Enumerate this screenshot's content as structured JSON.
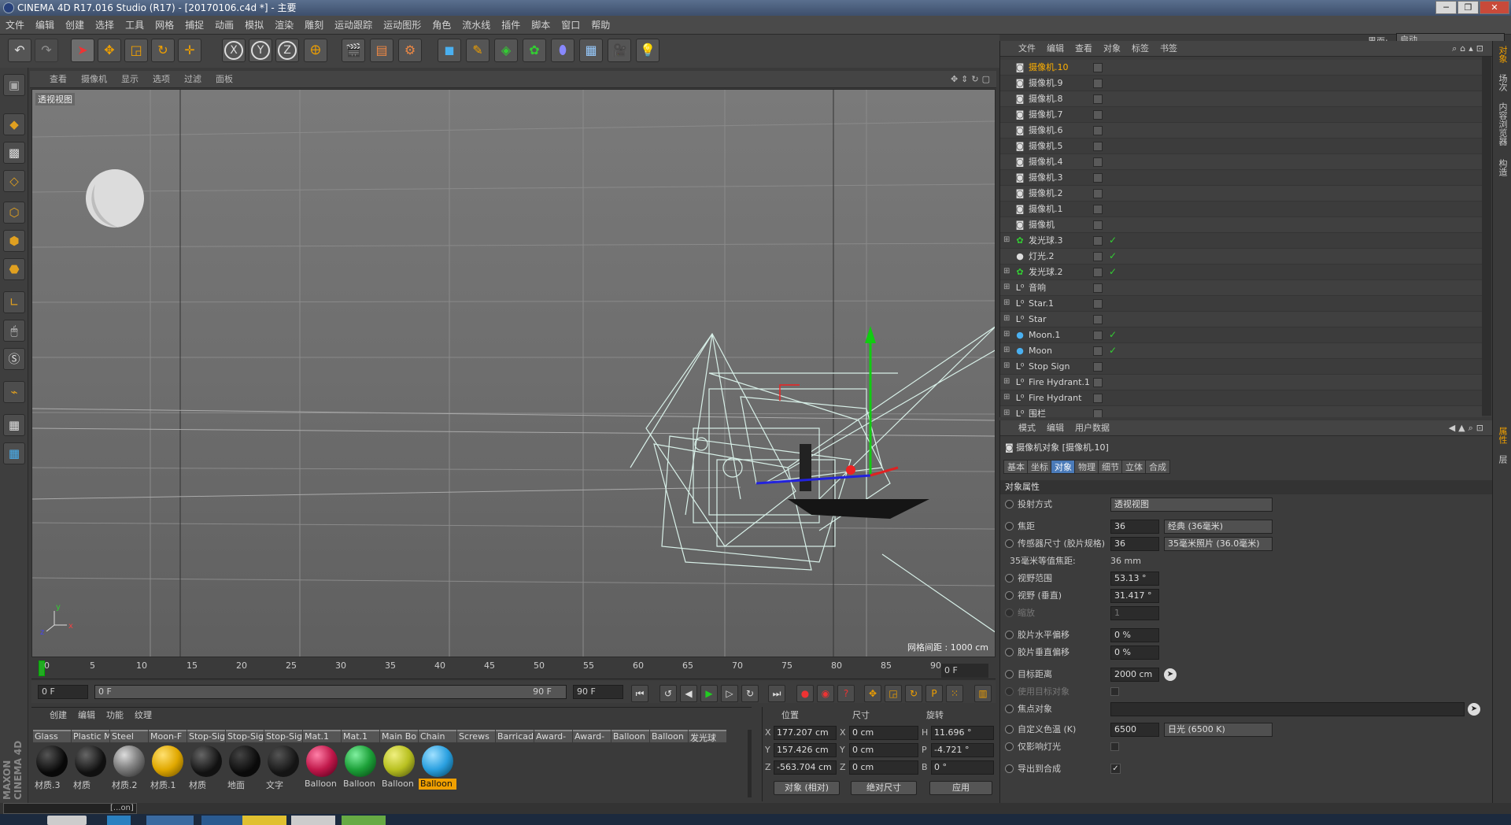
{
  "window": {
    "title": "CINEMA 4D R17.016 Studio (R17) - [20170106.c4d *] - 主要",
    "buttons": [
      "─",
      "❐",
      "✕"
    ]
  },
  "menu": [
    "文件",
    "编辑",
    "创建",
    "选择",
    "工具",
    "网格",
    "捕捉",
    "动画",
    "模拟",
    "渲染",
    "雕刻",
    "运动跟踪",
    "运动图形",
    "角色",
    "流水线",
    "插件",
    "脚本",
    "窗口",
    "帮助"
  ],
  "layout": {
    "label": "界面:",
    "value": "启动"
  },
  "toolbar": {
    "icons": [
      "undo-icon",
      "redo-icon",
      "select-arrow-icon",
      "move-icon",
      "scale-icon",
      "rotate-icon",
      "recent-tool-icon",
      "x-axis-icon",
      "y-axis-icon",
      "z-axis-icon",
      "world-coord-icon",
      "render-view-icon",
      "render-picture-viewer-icon",
      "render-settings-icon",
      "cube-icon",
      "pen-icon",
      "subdivision-icon",
      "cloner-icon",
      "deformer-icon",
      "floor-icon",
      "camera-icon",
      "light-icon"
    ],
    "axis_labels": [
      "X",
      "Y",
      "Z"
    ]
  },
  "viewport": {
    "menu": [
      "查看",
      "摄像机",
      "显示",
      "选项",
      "过滤",
      "面板"
    ],
    "label": "透视视图",
    "grid_info": "网格间距 : 1000 cm"
  },
  "timeline": {
    "ticks": [
      "0",
      "5",
      "10",
      "15",
      "20",
      "25",
      "30",
      "35",
      "40",
      "45",
      "50",
      "55",
      "60",
      "65",
      "70",
      "75",
      "80",
      "85",
      "90"
    ],
    "current": "0 F"
  },
  "playback": {
    "start": "0 F",
    "range_start": "0 F",
    "range_end": "90 F",
    "end": "90 F"
  },
  "materials": {
    "menu": [
      "创建",
      "编辑",
      "功能",
      "纹理"
    ],
    "items": [
      {
        "tab": "Glass",
        "label": "材质.3",
        "color": "#080808"
      },
      {
        "tab": "Plastic M",
        "label": "材质",
        "color": "#101010"
      },
      {
        "tab": "Steel",
        "label": "材质.2",
        "color": "#8a8a8a"
      },
      {
        "tab": "Moon-F",
        "label": "材质.1",
        "color": "#e0a800"
      },
      {
        "tab": "Stop-Sig",
        "label": "材质",
        "color": "#111111"
      },
      {
        "tab": "Stop-Sig",
        "label": "地面",
        "color": "#0a0a0a"
      },
      {
        "tab": "Stop-Sig",
        "label": "文字",
        "color": "#141414"
      },
      {
        "tab": "Mat.1",
        "label": "Balloon",
        "color": "#c0184a"
      },
      {
        "tab": "Mat.1",
        "label": "Balloon",
        "color": "#1ca038"
      },
      {
        "tab": "Main Bo",
        "label": "Balloon",
        "color": "#b8c020"
      },
      {
        "tab": "Chain",
        "label": "Balloon",
        "color": "#2aa0e0"
      }
    ],
    "extra_tabs": [
      "Screws",
      "Barricad",
      "Award-",
      "Award-",
      "Balloon",
      "Balloon",
      "发光球"
    ]
  },
  "coords": {
    "headers": [
      "位置",
      "尺寸",
      "旋转"
    ],
    "rows": [
      {
        "a": "X",
        "pos": "177.207 cm",
        "b": "X",
        "size": "0 cm",
        "c": "H",
        "rot": "11.696 °"
      },
      {
        "a": "Y",
        "pos": "157.426 cm",
        "b": "Y",
        "size": "0 cm",
        "c": "P",
        "rot": "-4.721 °"
      },
      {
        "a": "Z",
        "pos": "-563.704 cm",
        "b": "Z",
        "size": "0 cm",
        "c": "B",
        "rot": "0 °"
      }
    ],
    "mode1": "对象 (相对)",
    "mode2": "绝对尺寸",
    "apply": "应用"
  },
  "objects": {
    "menu": [
      "文件",
      "编辑",
      "查看",
      "对象",
      "标签",
      "书签"
    ],
    "items": [
      {
        "name": "摄像机.10",
        "icon": "camera-icon",
        "selected": true
      },
      {
        "name": "摄像机.9",
        "icon": "camera-icon"
      },
      {
        "name": "摄像机.8",
        "icon": "camera-icon"
      },
      {
        "name": "摄像机.7",
        "icon": "camera-icon"
      },
      {
        "name": "摄像机.6",
        "icon": "camera-icon"
      },
      {
        "name": "摄像机.5",
        "icon": "camera-icon"
      },
      {
        "name": "摄像机.4",
        "icon": "camera-icon"
      },
      {
        "name": "摄像机.3",
        "icon": "camera-icon"
      },
      {
        "name": "摄像机.2",
        "icon": "camera-icon"
      },
      {
        "name": "摄像机.1",
        "icon": "camera-icon"
      },
      {
        "name": "摄像机",
        "icon": "camera-icon"
      },
      {
        "name": "发光球.3",
        "icon": "cloner-icon"
      },
      {
        "name": "灯光.2",
        "icon": "light-icon"
      },
      {
        "name": "发光球.2",
        "icon": "cloner-icon"
      },
      {
        "name": "音响",
        "icon": "null-icon"
      },
      {
        "name": "Star.1",
        "icon": "null-icon"
      },
      {
        "name": "Star",
        "icon": "null-icon"
      },
      {
        "name": "Moon.1",
        "icon": "sphere-icon"
      },
      {
        "name": "Moon",
        "icon": "sphere-icon"
      },
      {
        "name": "Stop Sign",
        "icon": "null-icon"
      },
      {
        "name": "Fire Hydrant.1",
        "icon": "null-icon"
      },
      {
        "name": "Fire Hydrant",
        "icon": "null-icon"
      },
      {
        "name": "围栏",
        "icon": "null-icon"
      }
    ]
  },
  "attributes": {
    "menu": [
      "模式",
      "编辑",
      "用户数据"
    ],
    "title": "摄像机对象 [摄像机.10]",
    "tabs": [
      "基本",
      "坐标",
      "对象",
      "物理",
      "细节",
      "立体",
      "合成"
    ],
    "section": "对象属性",
    "rows": [
      {
        "label": "投射方式",
        "value": "",
        "dropdown": "透视视图"
      },
      {
        "label": "焦距",
        "value": "36",
        "dropdown": "经典 (36毫米)"
      },
      {
        "label": "传感器尺寸 (胶片规格)",
        "value": "36",
        "dropdown": "35毫米照片 (36.0毫米)"
      },
      {
        "label": "35毫米等值焦距:",
        "value": "36 mm",
        "dropdown": ""
      },
      {
        "label": "视野范围",
        "value": "53.13 °",
        "dropdown": ""
      },
      {
        "label": "视野 (垂直)",
        "value": "31.417 °",
        "dropdown": ""
      },
      {
        "label": "缩放",
        "value": "1",
        "dropdown": ""
      },
      {
        "label": "胶片水平偏移",
        "value": "0 %",
        "dropdown": ""
      },
      {
        "label": "胶片垂直偏移",
        "value": "0 %",
        "dropdown": ""
      },
      {
        "label": "目标距离",
        "value": "2000 cm",
        "dropdown": ""
      },
      {
        "label": "使用目标对象",
        "value": "",
        "dropdown": ""
      },
      {
        "label": "焦点对象",
        "value": "",
        "dropdown": ""
      },
      {
        "label": "自定义色温 (K)",
        "value": "6500",
        "dropdown": "日光 (6500 K)"
      },
      {
        "label": "仅影响灯光",
        "value": "",
        "dropdown": ""
      },
      {
        "label": "导出到合成",
        "value": "✓",
        "dropdown": ""
      }
    ]
  },
  "right_strip": [
    "对象",
    "场次",
    "内容浏览器",
    "构造",
    "属性",
    "层"
  ],
  "status": "[...on]",
  "logo": "MAXON CINEMA 4D"
}
